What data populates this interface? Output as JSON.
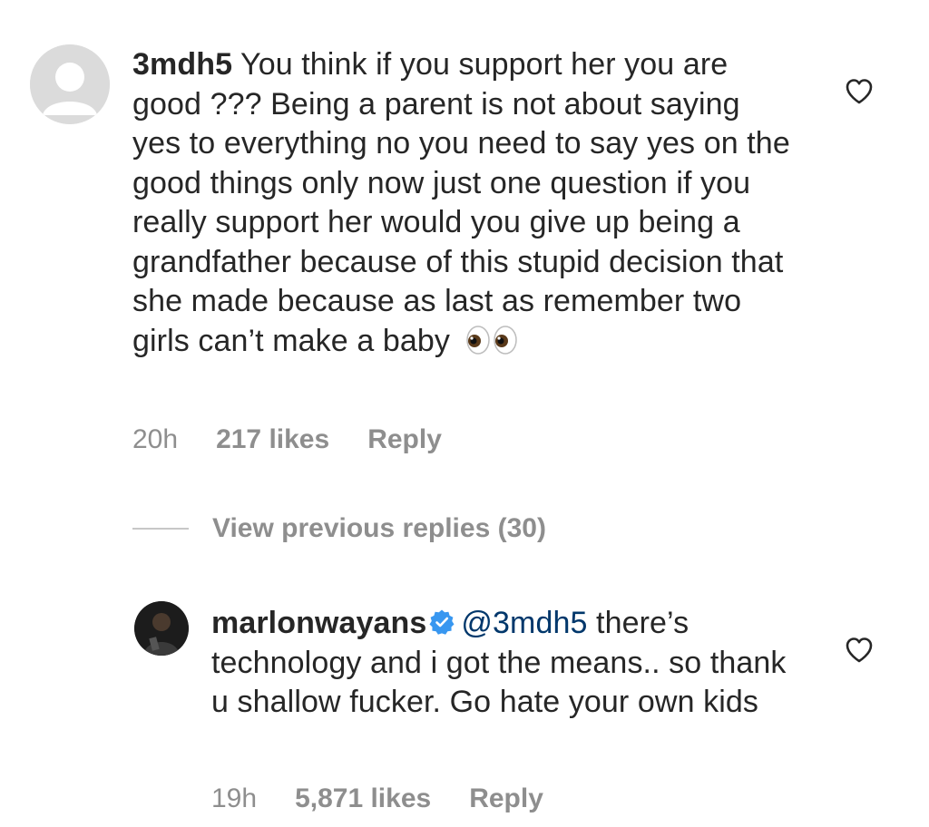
{
  "comment": {
    "username": "3mdh5",
    "text": "You think if you support her you are good ??? Being a parent is not about saying yes to everything no you need to say yes on the good things only now just one question if you really support her would you give up being a grandfather because of this stupid decision that she made because as last as remember two girls can’t make a baby",
    "emoji": "eyes",
    "time": "20h",
    "likes": "217 likes",
    "reply_label": "Reply",
    "like_icon": "heart-outline-icon"
  },
  "view_previous_replies": "View previous replies (30)",
  "reply": {
    "username": "marlonwayans",
    "verified": true,
    "mention": "@3mdh5",
    "text": "there’s technology and i got the means.. so thank u shallow fucker. Go hate your own kids",
    "time": "19h",
    "likes": "5,871 likes",
    "reply_label": "Reply",
    "like_icon": "heart-outline-icon"
  },
  "colors": {
    "text": "#262626",
    "secondary": "#8e8e8e",
    "mention": "#00376b",
    "verified": "#3897f0"
  }
}
